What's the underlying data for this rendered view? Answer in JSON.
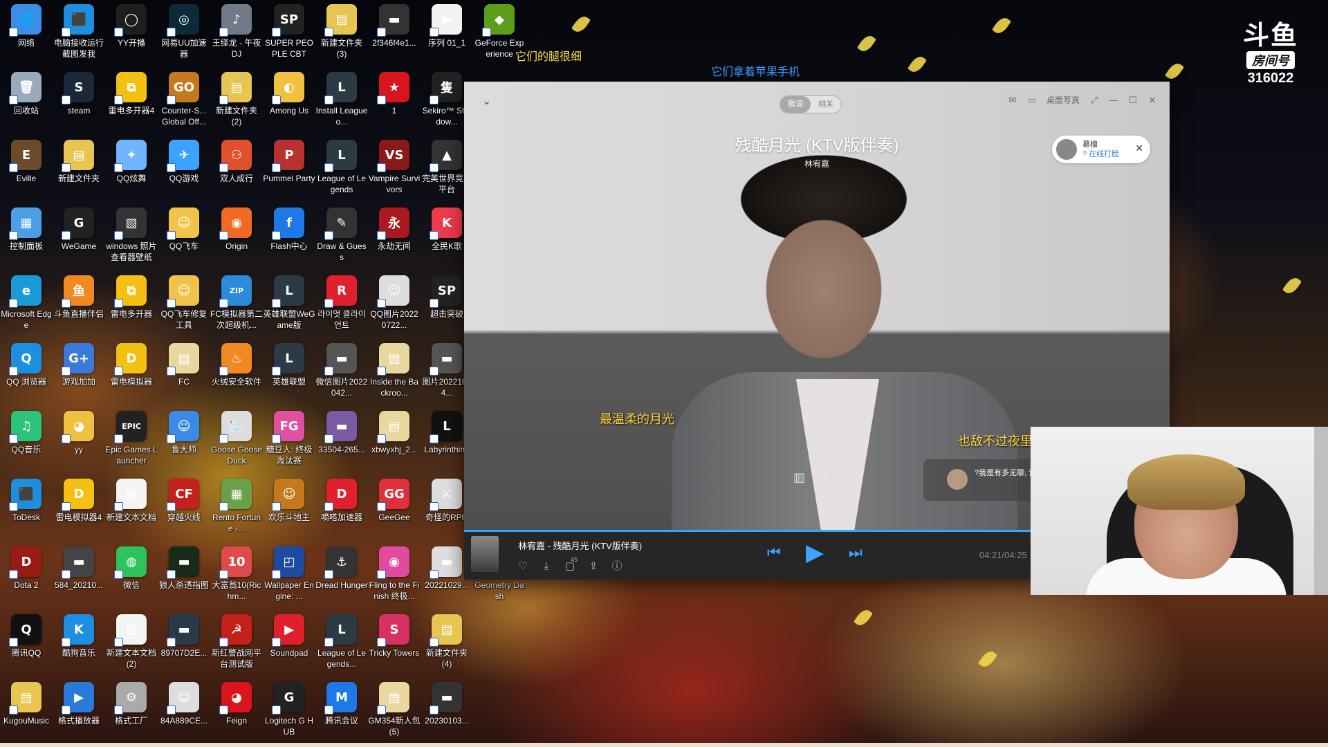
{
  "desktop_icons": [
    {
      "label": "网络",
      "color": "#3b8ee6",
      "glyph": "🌐"
    },
    {
      "label": "电脑接收运行截图发我",
      "color": "#1e8fe0",
      "glyph": "⬛"
    },
    {
      "label": "YY开播",
      "color": "#1e1e1e",
      "glyph": "◯"
    },
    {
      "label": "网易UU加速器",
      "color": "#0d2a3a",
      "glyph": "◎"
    },
    {
      "label": "王绎龙 - 午夜DJ",
      "color": "#707a88",
      "glyph": "♪"
    },
    {
      "label": "SUPER PEOPLE CBT",
      "color": "#222",
      "glyph": "SP"
    },
    {
      "label": "新建文件夹 (3)",
      "color": "#e8c450",
      "glyph": "▤"
    },
    {
      "label": "2f346f4e1...",
      "color": "#333",
      "glyph": "▬"
    },
    {
      "label": "序列 01_1",
      "color": "#f2f2f2",
      "glyph": "▶"
    },
    {
      "label": "GeForce Experience",
      "color": "#5a9e1a",
      "glyph": "◆"
    },
    {
      "label": "回收站",
      "color": "#9ab",
      "glyph": "🗑"
    },
    {
      "label": "steam",
      "color": "#1b2838",
      "glyph": "S"
    },
    {
      "label": "雷电多开器4",
      "color": "#f4c012",
      "glyph": "⧉"
    },
    {
      "label": "Counter-S... Global Off...",
      "color": "#c47a1c",
      "glyph": "GO"
    },
    {
      "label": "新建文件夹 (2)",
      "color": "#e8c450",
      "glyph": "▤"
    },
    {
      "label": "Among Us",
      "color": "#f0c040",
      "glyph": "◐"
    },
    {
      "label": "Install League o...",
      "color": "#2c3a44",
      "glyph": "L"
    },
    {
      "label": "1",
      "color": "#d8141c",
      "glyph": "★"
    },
    {
      "label": "Sekiro™ Shadow...",
      "color": "#222",
      "glyph": "隻"
    },
    {
      "label": "Eville",
      "color": "#6b4b2a",
      "glyph": "E"
    },
    {
      "label": "新建文件夹",
      "color": "#e8c450",
      "glyph": "▤"
    },
    {
      "label": "QQ炫舞",
      "color": "#6fb6ff",
      "glyph": "✦"
    },
    {
      "label": "QQ游戏",
      "color": "#3ba3ff",
      "glyph": "✈"
    },
    {
      "label": "双人成行",
      "color": "#e0502c",
      "glyph": "⚇"
    },
    {
      "label": "Pummel Party",
      "color": "#b83030",
      "glyph": "P"
    },
    {
      "label": "League of Legends",
      "color": "#2c3a44",
      "glyph": "L"
    },
    {
      "label": "Vampire Survivors",
      "color": "#8a1a1a",
      "glyph": "VS"
    },
    {
      "label": "完美世界竞技平台",
      "color": "#333",
      "glyph": "▲"
    },
    {
      "label": "控制面板",
      "color": "#4aa0e6",
      "glyph": "▦"
    },
    {
      "label": "WeGame",
      "color": "#222",
      "glyph": "G"
    },
    {
      "label": "windows 照片查看器壁纸",
      "color": "#333",
      "glyph": "▧"
    },
    {
      "label": "QQ飞车",
      "color": "#f0c44a",
      "glyph": "☺"
    },
    {
      "label": "Origin",
      "color": "#f06a22",
      "glyph": "◉"
    },
    {
      "label": "Flash中心",
      "color": "#1e78e6",
      "glyph": "f"
    },
    {
      "label": "Draw & Guess",
      "color": "#333",
      "glyph": "✎"
    },
    {
      "label": "永劫无间",
      "color": "#aa1820",
      "glyph": "永"
    },
    {
      "label": "全民K歌",
      "color": "#f03a4a",
      "glyph": "K"
    },
    {
      "label": "Microsoft Edge",
      "color": "#1a9ad6",
      "glyph": "e"
    },
    {
      "label": "斗鱼直播伴侣",
      "color": "#f08a20",
      "glyph": "鱼"
    },
    {
      "label": "雷电多开器",
      "color": "#f4c012",
      "glyph": "⧉"
    },
    {
      "label": "QQ飞车修复工具",
      "color": "#f0c44a",
      "glyph": "☺"
    },
    {
      "label": "FC模拟器第二次超级机...",
      "color": "#2c8ad8",
      "glyph": "ZIP"
    },
    {
      "label": "英雄联盟WeGame版",
      "color": "#2c3a44",
      "glyph": "L"
    },
    {
      "label": "라이엇 클라이언트",
      "color": "#e0202c",
      "glyph": "R"
    },
    {
      "label": "QQ图片20220722...",
      "color": "#ddd",
      "glyph": "☺"
    },
    {
      "label": "超击突破",
      "color": "#222",
      "glyph": "SP"
    },
    {
      "label": "QQ 浏览器",
      "color": "#1e8fe0",
      "glyph": "Q"
    },
    {
      "label": "游戏加加",
      "color": "#3a7ad8",
      "glyph": "G+"
    },
    {
      "label": "雷电模拟器",
      "color": "#f4c012",
      "glyph": "D"
    },
    {
      "label": "FC",
      "color": "#e8d8a0",
      "glyph": "▤"
    },
    {
      "label": "火绒安全软件",
      "color": "#f08a20",
      "glyph": "♨"
    },
    {
      "label": "英雄联盟",
      "color": "#2c3a44",
      "glyph": "L"
    },
    {
      "label": "微信图片2022042...",
      "color": "#555",
      "glyph": "▬"
    },
    {
      "label": "Inside the Backroo...",
      "color": "#e8d8a0",
      "glyph": "▤"
    },
    {
      "label": "图片20221014...",
      "color": "#555",
      "glyph": "▬"
    },
    {
      "label": "QQ音乐",
      "color": "#2cc47a",
      "glyph": "♫"
    },
    {
      "label": "yy",
      "color": "#f0c040",
      "glyph": "◕"
    },
    {
      "label": "Epic Games Launcher",
      "color": "#222",
      "glyph": "EPIC"
    },
    {
      "label": "鲁大师",
      "color": "#3a8ae6",
      "glyph": "☺"
    },
    {
      "label": "Goose Goose Duck",
      "color": "#ddd",
      "glyph": "🦢"
    },
    {
      "label": "糖豆人: 终极淘汰赛",
      "color": "#e050a0",
      "glyph": "FG"
    },
    {
      "label": "33504-265...",
      "color": "#7a5aa0",
      "glyph": "▬"
    },
    {
      "label": "xbwyxhj_2...",
      "color": "#e8d8a0",
      "glyph": "▤"
    },
    {
      "label": "Labyrinthine",
      "color": "#111",
      "glyph": "L"
    },
    {
      "label": "ToDesk",
      "color": "#1e8fe0",
      "glyph": "⬛"
    },
    {
      "label": "雷电模拟器4",
      "color": "#f4c012",
      "glyph": "D"
    },
    {
      "label": "新建文本文档",
      "color": "#f4f4f4",
      "glyph": "▤"
    },
    {
      "label": "穿越火线",
      "color": "#c4201c",
      "glyph": "CF"
    },
    {
      "label": "Rento Fortune -...",
      "color": "#6aa04a",
      "glyph": "▦"
    },
    {
      "label": "欢乐斗地主",
      "color": "#c47a1c",
      "glyph": "☺"
    },
    {
      "label": "嘀嗒加速器",
      "color": "#e0202c",
      "glyph": "D"
    },
    {
      "label": "GeeGee",
      "color": "#e0303c",
      "glyph": "GG"
    },
    {
      "label": "奇怪的RPG",
      "color": "#ddd",
      "glyph": "⚔"
    },
    {
      "label": "Dota 2",
      "color": "#9a1a14",
      "glyph": "D"
    },
    {
      "label": "584_20210...",
      "color": "#444",
      "glyph": "▬"
    },
    {
      "label": "微信",
      "color": "#2cc45a",
      "glyph": "◍"
    },
    {
      "label": "狼人杀透指图",
      "color": "#1a2a1a",
      "glyph": "▬"
    },
    {
      "label": "大富翁10(Richm...",
      "color": "#e04a4a",
      "glyph": "10"
    },
    {
      "label": "Wallpaper Engine: ...",
      "color": "#1e4aa0",
      "glyph": "◰"
    },
    {
      "label": "Dread Hunger",
      "color": "#333",
      "glyph": "⚓"
    },
    {
      "label": "Fling to the Finish 终极...",
      "color": "#e04aa0",
      "glyph": "◉"
    },
    {
      "label": "20221029...",
      "color": "#ddd",
      "glyph": "▬"
    },
    {
      "label": "Geometry Dash",
      "color": "#333",
      "glyph": "◇"
    },
    {
      "label": "腾讯QQ",
      "color": "#111",
      "glyph": "Q"
    },
    {
      "label": "酷狗音乐",
      "color": "#1e8fe0",
      "glyph": "K"
    },
    {
      "label": "新建文本文档 (2)",
      "color": "#f4f4f4",
      "glyph": "▤"
    },
    {
      "label": "89707D2E...",
      "color": "#2a3a4a",
      "glyph": "▬"
    },
    {
      "label": "新红警战网平台测试版",
      "color": "#c4201c",
      "glyph": "☭"
    },
    {
      "label": "Soundpad",
      "color": "#e0202c",
      "glyph": "▶"
    },
    {
      "label": "League of Legends...",
      "color": "#2c3a44",
      "glyph": "L"
    },
    {
      "label": "Tricky Towers",
      "color": "#d83060",
      "glyph": "S"
    },
    {
      "label": "新建文件夹 (4)",
      "color": "#e8c450",
      "glyph": "▤"
    },
    {
      "label": "KugouMusic",
      "color": "#e8c450",
      "glyph": "▤"
    },
    {
      "label": "格式播放器",
      "color": "#2a7ad8",
      "glyph": "▶"
    },
    {
      "label": "格式工厂",
      "color": "#aaa",
      "glyph": "⚙"
    },
    {
      "label": "84A889CE...",
      "color": "#ddd",
      "glyph": "☺"
    },
    {
      "label": "Feign",
      "color": "#d8141c",
      "glyph": "◕"
    },
    {
      "label": "Logitech G HUB",
      "color": "#222",
      "glyph": "G"
    },
    {
      "label": "腾讯会议",
      "color": "#1e78e6",
      "glyph": "M"
    },
    {
      "label": "GM354新人包 (5)",
      "color": "#e8d8a0",
      "glyph": "▤"
    },
    {
      "label": "20230103...",
      "color": "#333",
      "glyph": "▬"
    }
  ],
  "overlay": {
    "lyric_top": "它们的腿很细",
    "lyric_mid": "它们拿着苹果手机"
  },
  "douyu": {
    "logo": "斗鱼",
    "room_label": "房间号",
    "room_number": "316022"
  },
  "player": {
    "tabs": [
      "歌词",
      "相关"
    ],
    "active_tab": 0,
    "desktop_lyrics_label": "桌面写真",
    "song_title": "残酷月光 (KTV版伴奏)",
    "artist": "林宥嘉",
    "reward_name": "慕檀",
    "reward_sub": "? 在线打脸",
    "lyric_left": "最温柔的月光",
    "lyric_right": "也敌不过夜里",
    "comment_text": "?我是有多无聊, 论",
    "now_playing": "林宥嘉 - 残酷月光 (KTV版伴奏)",
    "comment_count": "45",
    "time": "04:21/04:25",
    "progress": 0.984,
    "accent_color": "#31a8ff"
  },
  "icons": {
    "collapse": "chevron-down-icon",
    "mail": "mail-icon",
    "desktop": "monitor-icon",
    "fullscreen": "expand-icon",
    "minimize": "minimize-icon",
    "maximize": "maximize-icon",
    "close": "close-icon"
  }
}
